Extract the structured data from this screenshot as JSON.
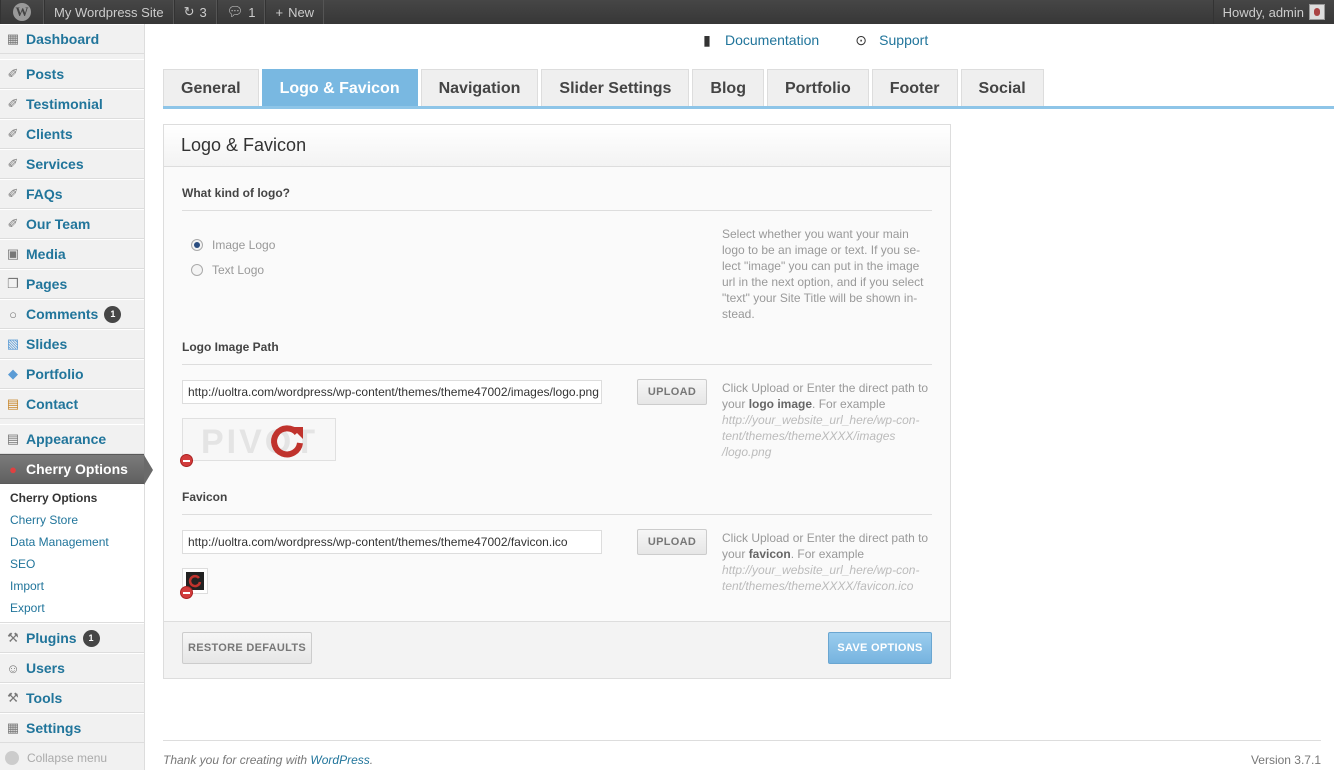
{
  "adminbar": {
    "site_name": "My Wordpress Site",
    "updates_count": "3",
    "comments_count": "1",
    "new_label": "New",
    "howdy": "Howdy, admin"
  },
  "sidebar": {
    "items": [
      {
        "label": "Dashboard",
        "icon": "dashboard-icon"
      },
      {
        "label": "Posts",
        "icon": "pin-icon"
      },
      {
        "label": "Testimonial",
        "icon": "pin-icon"
      },
      {
        "label": "Clients",
        "icon": "pin-icon"
      },
      {
        "label": "Services",
        "icon": "pin-icon"
      },
      {
        "label": "FAQs",
        "icon": "pin-icon"
      },
      {
        "label": "Our Team",
        "icon": "pin-icon"
      },
      {
        "label": "Media",
        "icon": "media-icon"
      },
      {
        "label": "Pages",
        "icon": "pages-icon"
      },
      {
        "label": "Comments",
        "icon": "comments-icon",
        "badge": "1"
      },
      {
        "label": "Slides",
        "icon": "slides-icon"
      },
      {
        "label": "Portfolio",
        "icon": "portfolio-icon"
      },
      {
        "label": "Contact",
        "icon": "contact-icon"
      },
      {
        "label": "Appearance",
        "icon": "appearance-icon"
      },
      {
        "label": "Cherry Options",
        "icon": "cherry-icon"
      },
      {
        "label": "Plugins",
        "icon": "plugins-icon",
        "badge": "1"
      },
      {
        "label": "Users",
        "icon": "users-icon"
      },
      {
        "label": "Tools",
        "icon": "tools-icon"
      },
      {
        "label": "Settings",
        "icon": "settings-icon"
      }
    ],
    "submenu": [
      "Cherry Options",
      "Cherry Store",
      "Data Management",
      "SEO",
      "Import",
      "Export"
    ],
    "collapse_label": "Collapse menu"
  },
  "doclinks": {
    "documentation": "Documentation",
    "support": "Support"
  },
  "tabs": [
    "General",
    "Logo & Favicon",
    "Navigation",
    "Slider Settings",
    "Blog",
    "Portfolio",
    "Footer",
    "Social"
  ],
  "active_tab": "Logo & Favicon",
  "panel": {
    "title": "Logo & Favicon",
    "logo_kind": {
      "title": "What kind of logo?",
      "options": [
        "Image Logo",
        "Text Logo"
      ],
      "selected": "Image Logo",
      "desc_lines": [
        "Select whether you want your main",
        "logo to be an image or text. If you se-",
        "lect \"image\" you can put in the image",
        "url in the next option, and if you select",
        "\"text\" your Site Title will be shown in-",
        "stead."
      ]
    },
    "logo_path": {
      "title": "Logo Image Path",
      "value": "http://uoltra.com/wordpress/wp-content/themes/theme47002/images/logo.png",
      "upload_label": "UPLOAD",
      "preview_text": "PIVOT",
      "desc_prefix": "Click Upload or Enter the direct path to",
      "desc_your": "your",
      "desc_bold": "logo image",
      "desc_suffix": ". For example",
      "example_lines": [
        "http://your_website_url_here/wp-con-",
        "tent/themes/themeXXXX/images",
        "/logo.png"
      ]
    },
    "favicon": {
      "title": "Favicon",
      "value": "http://uoltra.com/wordpress/wp-content/themes/theme47002/favicon.ico",
      "upload_label": "UPLOAD",
      "desc_prefix": "Click Upload or Enter the direct path to",
      "desc_your": "your",
      "desc_bold": "favicon",
      "desc_suffix": ". For example",
      "example_lines": [
        "http://your_website_url_here/wp-con-",
        "tent/themes/themeXXXX/favicon.ico"
      ]
    },
    "restore_label": "RESTORE DEFAULTS",
    "save_label": "SAVE OPTIONS"
  },
  "footer": {
    "thanks_prefix": "Thank you for creating with",
    "wordpress_link": "WordPress",
    "version": "Version 3.7.1"
  },
  "colors": {
    "accent": "#79b8e1",
    "link": "#21759b",
    "logo_red": "#c0332d"
  }
}
